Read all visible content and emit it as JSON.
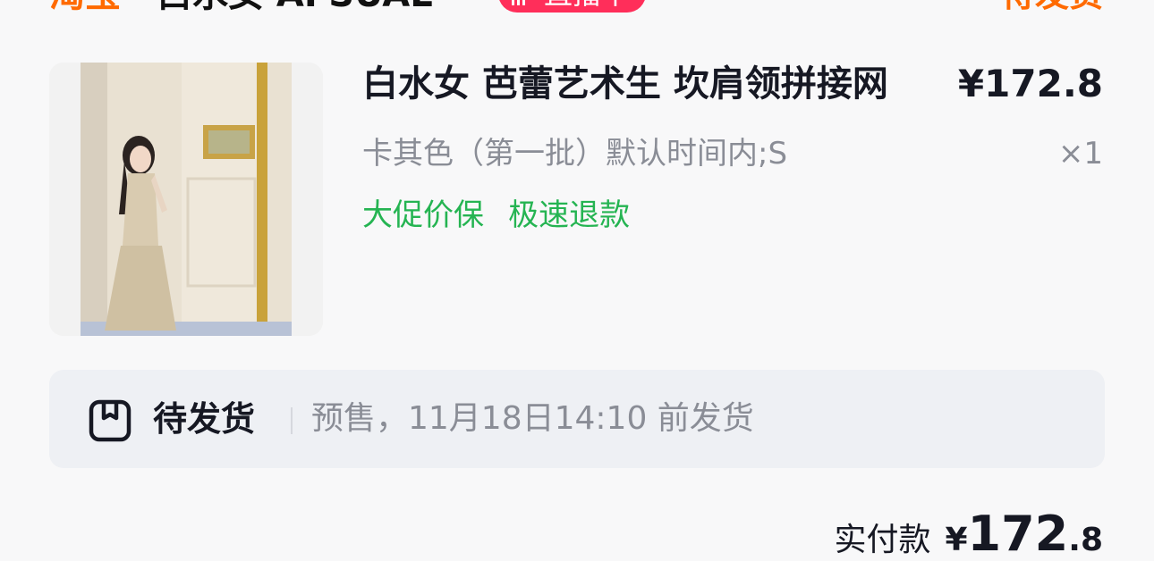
{
  "header": {
    "store_badge": "淘宝",
    "store_name": "白水女 AFSUAL",
    "live_label": "直播中",
    "status": "待发货"
  },
  "product": {
    "title": "白水女 芭蕾艺术生 坎肩领拼接网",
    "price": "¥172.8",
    "sku": "卡其色（第一批）默认时间内;S",
    "quantity": "×1",
    "tags": [
      "大促价保",
      "极速退款"
    ]
  },
  "shipping": {
    "status": "待发货",
    "description": "预售，11月18日14:10 前发货"
  },
  "payment": {
    "label": "实付款",
    "currency": "¥",
    "amount_int": "172",
    "amount_dec": ".8"
  },
  "colors": {
    "accent_orange": "#ff6a00",
    "live_red": "#ff2e5a",
    "tag_green": "#25b452",
    "text_primary": "#161823",
    "text_secondary": "#8a8d96"
  }
}
